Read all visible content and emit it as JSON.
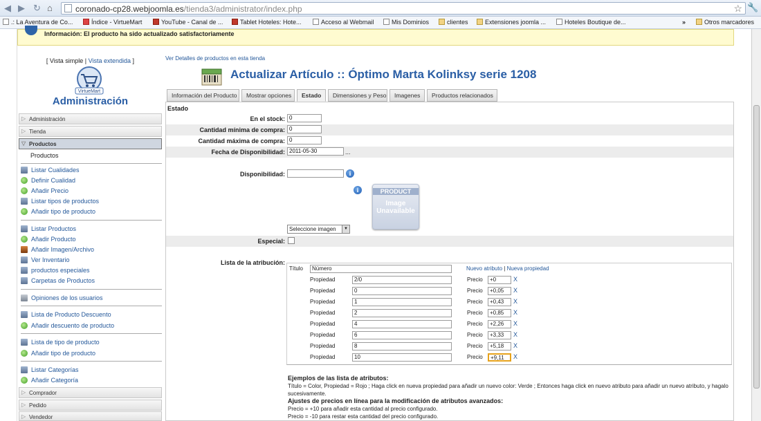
{
  "browser": {
    "url": "coronado-cp28.webjoomla.es/tienda3/administrator/index.php",
    "url_host": "coronado-cp28.webjoomla.es",
    "url_path": "/tienda3/administrator/index.php",
    "bookmarks": [
      ".: La Aventura de Co...",
      "Índice - VirtueMart",
      "YouTube - Canal de ...",
      "Tablet Hoteles: Hote...",
      "Acceso al Webmail",
      "Mis Dominios",
      "clientes",
      "Extensiones joomla ...",
      "Hoteles Boutique de..."
    ],
    "overflow": "»",
    "other_bookmarks": "Otros marcadores"
  },
  "message": "Información: El producto ha sido actualizado satisfactoriamente",
  "sidebar": {
    "view_simple": "[ Vista simple |",
    "view_extended": "Vista extendida",
    "view_close": "]",
    "logo_text": "VirtueMart",
    "title": "Administración",
    "sections": {
      "admin": "Administración",
      "store": "Tienda",
      "products": "Productos",
      "buyer": "Comprador",
      "order": "Pedido",
      "seller": "Vendedor"
    },
    "products_sub": "Productos",
    "items": [
      "Listar Cualidades",
      "Definir Cualidad",
      "Añadir Precio",
      "Listar tipos de productos",
      "Añadir tipo de producto",
      "Listar Productos",
      "Añadir Producto",
      "Añadir Imagen/Archivo",
      "Ver Inventario",
      "productos especiales",
      "Carpetas de Productos",
      "Opiniones de los usuarios",
      "Lista de Producto Descuento",
      "Añadir descuento de producto",
      "Lista de tipo de producto",
      "Añadir tipo de producto",
      "Listar Categorías",
      "Añadir Categoría"
    ]
  },
  "main": {
    "detail_link": "Ver Detalles de productos en esta tienda",
    "title": "Actualizar Artículo :: Óptimo Marta Kolinksy serie 1208",
    "tabs": [
      "Información del Producto",
      "Mostrar opciones",
      "Estado",
      "Dimensiones y Peso",
      "Imagenes",
      "Productos relacionados"
    ],
    "section": "Estado",
    "fields": {
      "stock_label": "En el stock:",
      "stock": "0",
      "min_label": "Cantidad mínima de compra:",
      "min": "0",
      "max_label": "Cantidad máxima de compra:",
      "max": "0",
      "date_label": "Fecha de Disponibilidad:",
      "date": "2011-05-30",
      "date_btn": "...",
      "avail_label": "Disponibilidad:",
      "avail": "",
      "no_image_top": "PRODUCT",
      "no_image_bottom": "Image Unavailable",
      "image_select": "Seleccione imagen",
      "special_label": "Especial:",
      "attr_label": "Lista de la atribución:"
    },
    "attributes": {
      "title_label": "Título",
      "title_value": "Número",
      "new_attr": "Nuevo atributo",
      "sep": "|",
      "new_prop": "Nueva propiedad",
      "prop_label": "Propiedad",
      "price_label": "Precio",
      "remove": "X",
      "rows": [
        {
          "prop": "2/0",
          "price": "+0"
        },
        {
          "prop": "0",
          "price": "+0,05"
        },
        {
          "prop": "1",
          "price": "+0,43"
        },
        {
          "prop": "2",
          "price": "+0,85"
        },
        {
          "prop": "4",
          "price": "+2,26"
        },
        {
          "prop": "6",
          "price": "+3,33"
        },
        {
          "prop": "8",
          "price": "+5,18"
        },
        {
          "prop": "10",
          "price": "+9,11"
        }
      ]
    },
    "examples": {
      "h1": "Ejemplos de las lista de atributos:",
      "p1": "Título = Color, Propiedad = Rojo ; Haga click en nueva propiedad para añadir un nuevo color: Verde ; Entonces haga click en nuevo atributo para añadir un nuevo atributo, y hagalo sucesivamente.",
      "h2": "Ajustes de precios en línea para la modificación de atributos avanzados:",
      "p2": "Precio = +10 para añadir esta cantidad al precio configurado.",
      "p3": "Precio = -10 para restar esta cantidad del precio configurado."
    }
  }
}
